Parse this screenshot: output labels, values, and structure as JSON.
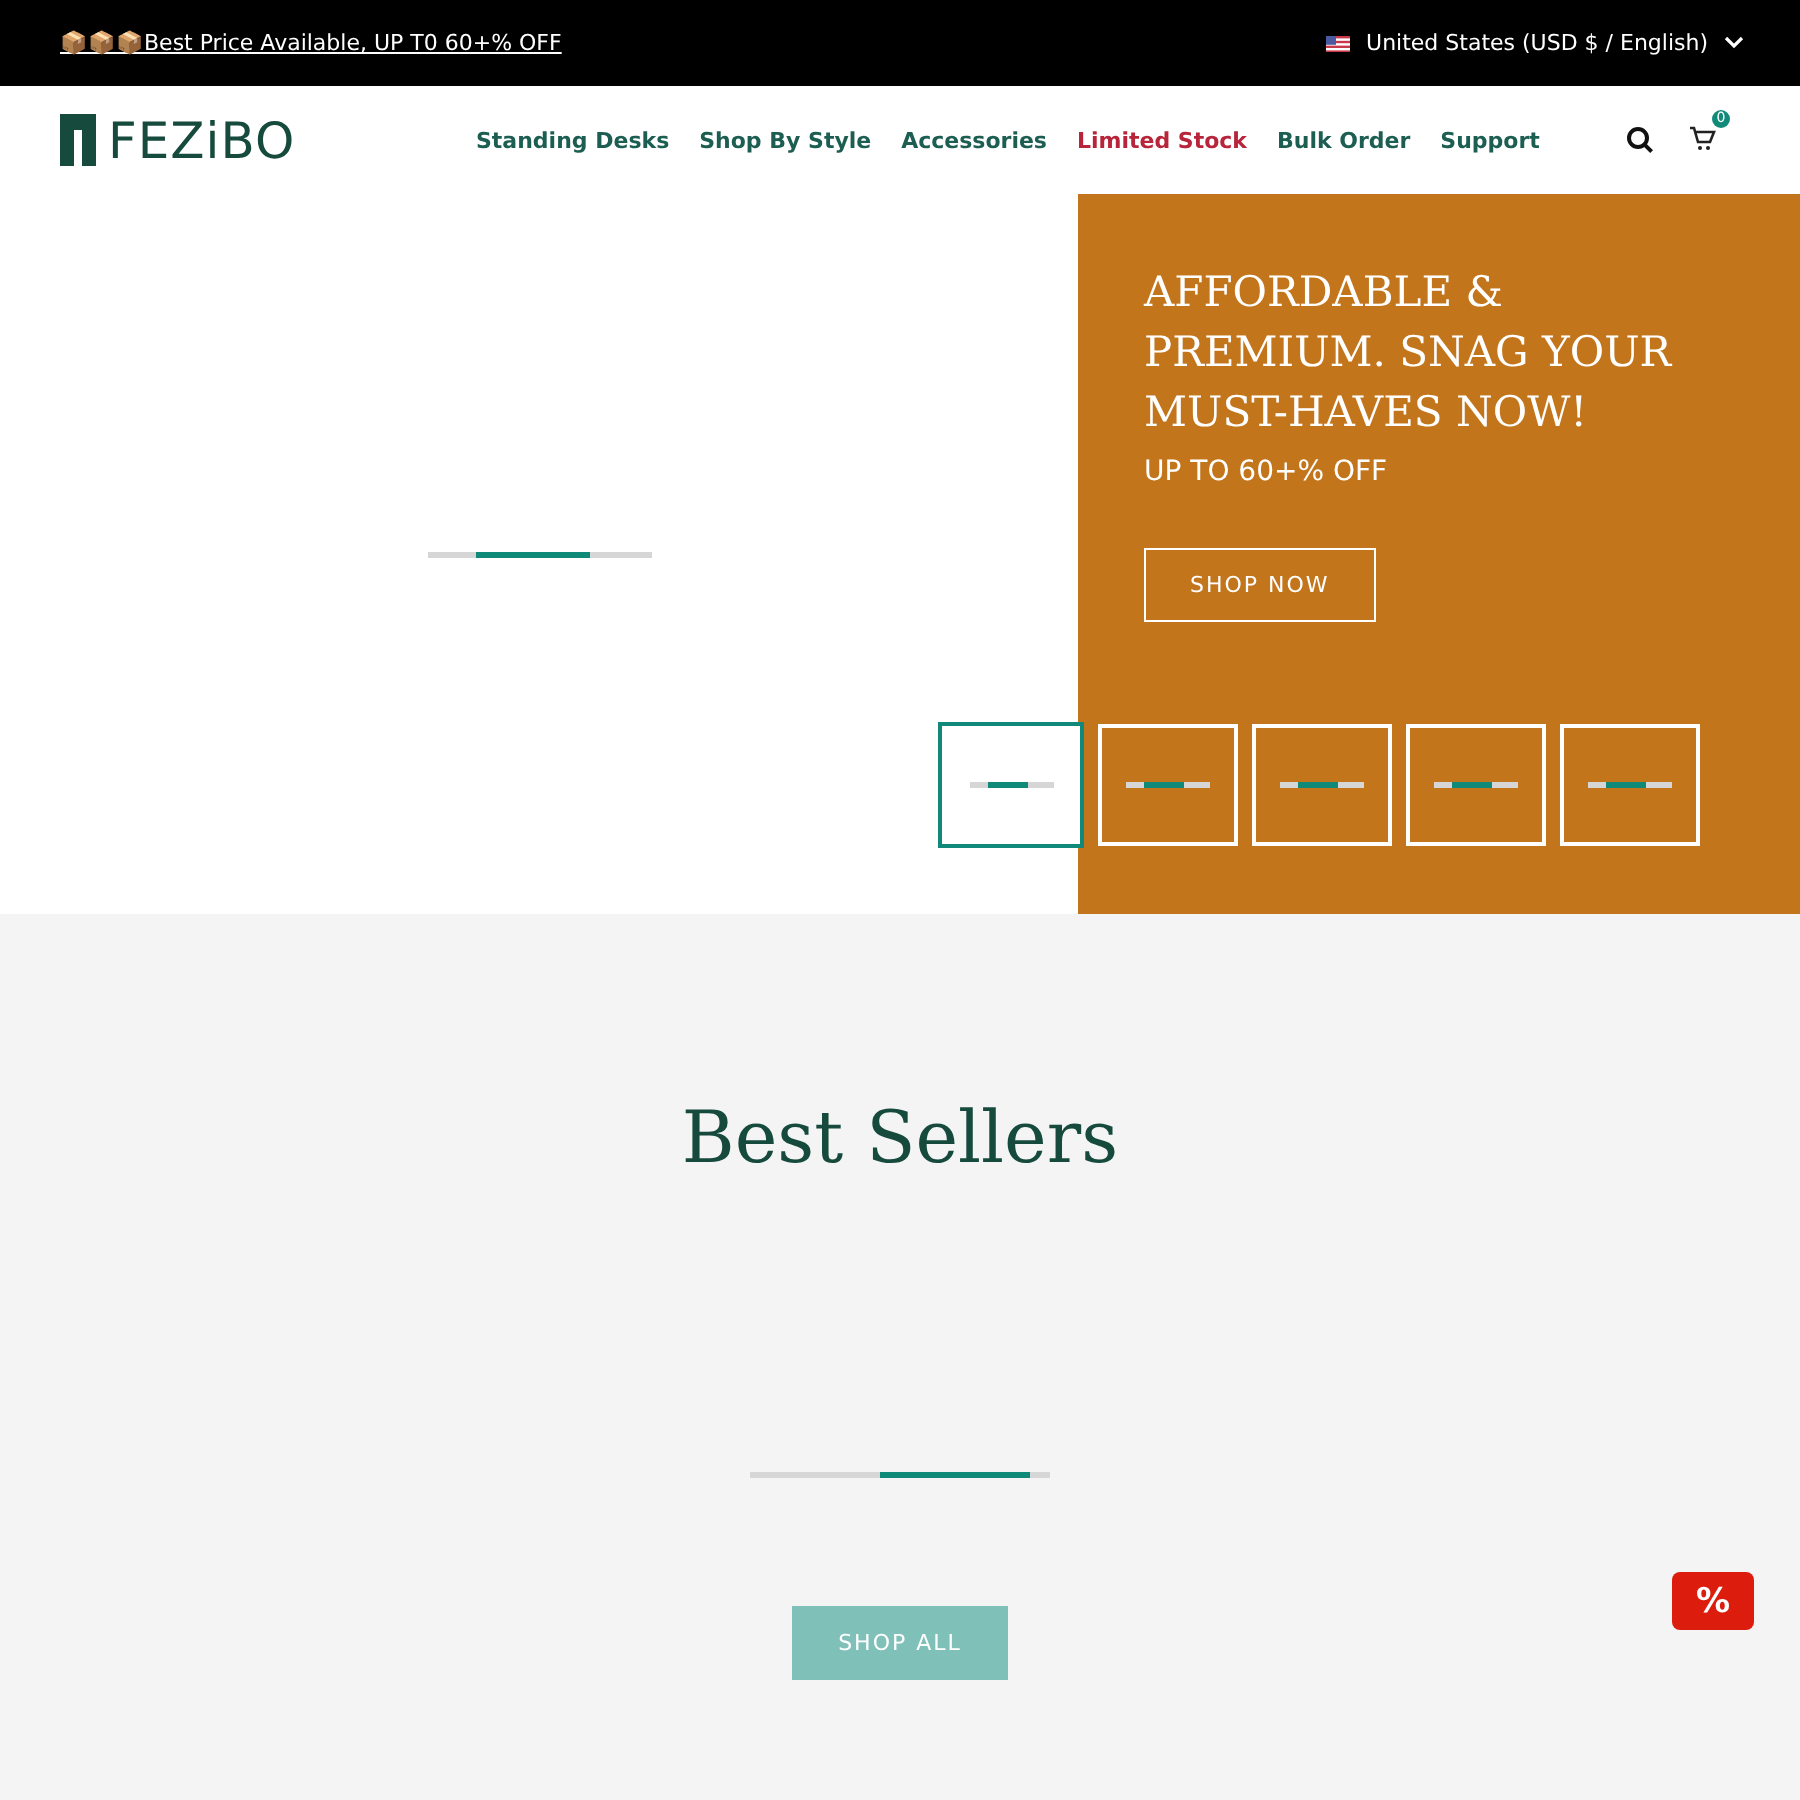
{
  "announcement": {
    "text": "📦📦📦Best Price Available, UP T0 60+% OFF",
    "locale": "United States (USD $ / English)"
  },
  "header": {
    "logo": "FEZiBO",
    "nav": [
      {
        "label": "Standing Desks",
        "kind": "normal"
      },
      {
        "label": "Shop By Style",
        "kind": "normal"
      },
      {
        "label": "Accessories",
        "kind": "normal"
      },
      {
        "label": "Limited Stock",
        "kind": "highlight"
      },
      {
        "label": "Bulk Order",
        "kind": "normal"
      },
      {
        "label": "Support",
        "kind": "normal"
      }
    ],
    "cart_count": "0"
  },
  "hero": {
    "headline": "AFFORDABLE & PREMIUM. SNAG YOUR MUST-HAVES NOW!",
    "subheadline": "UP TO 60+% OFF",
    "button": "SHOP NOW",
    "thumbnails": [
      {
        "selected": true
      },
      {
        "selected": false
      },
      {
        "selected": false
      },
      {
        "selected": false
      },
      {
        "selected": false
      }
    ]
  },
  "best_sellers": {
    "title": "Best Sellers",
    "button": "SHOP ALL"
  },
  "coupon": {
    "symbol": "%"
  }
}
